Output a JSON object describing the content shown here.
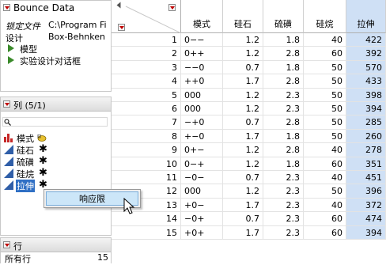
{
  "top_panel": {
    "title": "Bounce Data",
    "locked_file_label": "锁定文件",
    "locked_file_value": "C:\\Program Fi",
    "design_label": "设计",
    "design_value": "Box-Behnken",
    "scripts": [
      "模型",
      "实验设计对话框"
    ]
  },
  "columns_panel": {
    "title": "列 (5/1)",
    "items": [
      {
        "name": "模式",
        "marker": ""
      },
      {
        "name": "硅石",
        "marker": "✱"
      },
      {
        "name": "硫磺",
        "marker": "✱"
      },
      {
        "name": "硅烷",
        "marker": "✱"
      },
      {
        "name": "拉伸",
        "marker": "✱"
      }
    ]
  },
  "rows_panel": {
    "title": "行",
    "all_rows_label": "所有行",
    "all_rows_value": "15"
  },
  "context_menu": {
    "item": "响应限"
  },
  "table": {
    "headers": [
      "模式",
      "硅石",
      "硫磺",
      "硅烷",
      "拉伸"
    ],
    "rows": [
      [
        "1",
        "0−−",
        "1.2",
        "1.8",
        "40",
        "422"
      ],
      [
        "2",
        "0++",
        "1.2",
        "2.8",
        "60",
        "392"
      ],
      [
        "3",
        "−−0",
        "0.7",
        "1.8",
        "50",
        "570"
      ],
      [
        "4",
        "++0",
        "1.7",
        "2.8",
        "50",
        "433"
      ],
      [
        "5",
        "000",
        "1.2",
        "2.3",
        "50",
        "398"
      ],
      [
        "6",
        "000",
        "1.2",
        "2.3",
        "50",
        "394"
      ],
      [
        "7",
        "−+0",
        "0.7",
        "2.8",
        "50",
        "285"
      ],
      [
        "8",
        "+−0",
        "1.7",
        "1.8",
        "50",
        "260"
      ],
      [
        "9",
        "0+−",
        "1.2",
        "2.8",
        "40",
        "278"
      ],
      [
        "10",
        "0−+",
        "1.2",
        "1.8",
        "60",
        "351"
      ],
      [
        "11",
        "−0−",
        "0.7",
        "2.3",
        "40",
        "451"
      ],
      [
        "12",
        "000",
        "1.2",
        "2.3",
        "50",
        "396"
      ],
      [
        "13",
        "+0−",
        "1.7",
        "2.3",
        "40",
        "372"
      ],
      [
        "14",
        "−0+",
        "0.7",
        "2.3",
        "60",
        "474"
      ],
      [
        "15",
        "+0+",
        "1.7",
        "2.3",
        "60",
        "394"
      ]
    ]
  },
  "colors": {
    "selected_column": "#cfe0f5",
    "menu_highlight": "#cce6f8",
    "script_icon": "#3a8a2a",
    "red_triangle": "#c00000"
  }
}
